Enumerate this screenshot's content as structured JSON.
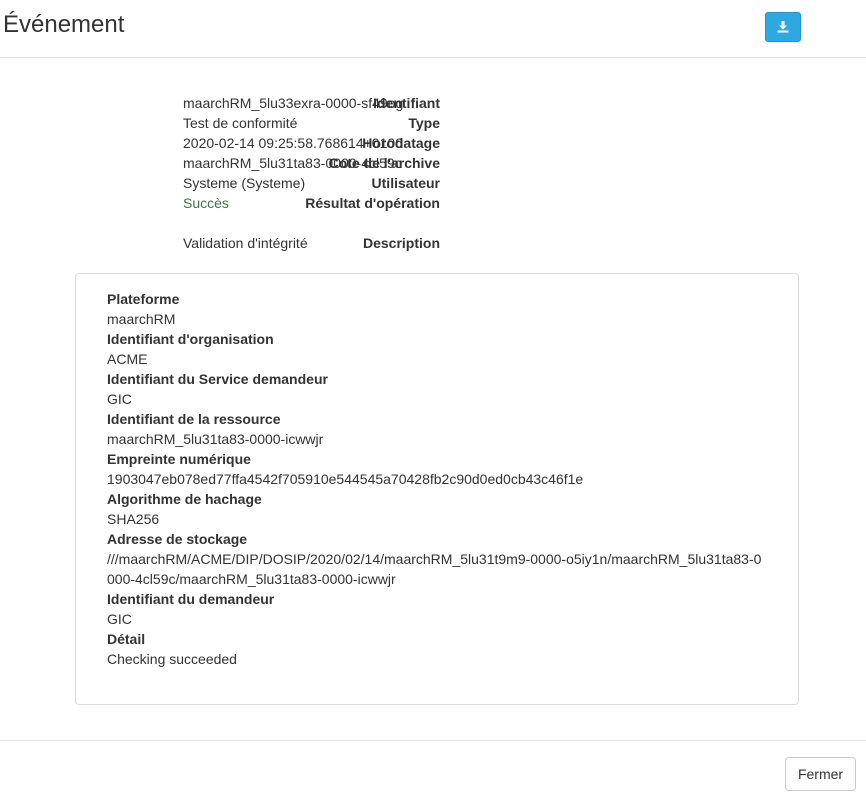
{
  "modal": {
    "title": "Événement",
    "download_icon": "download-icon",
    "close_label": "Fermer"
  },
  "fields": [
    {
      "label": "Identifiant",
      "value": "maarchRM_5lu33exra-0000-sf49og"
    },
    {
      "label": "Type",
      "value": "Test de conformité"
    },
    {
      "label": "Horodatage",
      "value": "2020-02-14 09:25:58.768614+0100"
    },
    {
      "label": "Cote de l'archive",
      "value": "maarchRM_5lu31ta83-0000-4cl59c"
    },
    {
      "label": "Utilisateur",
      "value": "Systeme (Systeme)"
    },
    {
      "label": "Résultat d'opération",
      "value": "Succès"
    }
  ],
  "description": {
    "label": "Description",
    "value": "Validation d'intégrité"
  },
  "details": [
    {
      "key": "Plateforme",
      "value": "maarchRM"
    },
    {
      "key": "Identifiant d'organisation",
      "value": "ACME"
    },
    {
      "key": "Identifiant du Service demandeur",
      "value": "GIC"
    },
    {
      "key": "Identifiant de la ressource",
      "value": "maarchRM_5lu31ta83-0000-icwwjr"
    },
    {
      "key": "Empreinte numérique",
      "value": "1903047eb078ed77ffa4542f705910e544545a70428fb2c90d0ed0cb43c46f1e"
    },
    {
      "key": "Algorithme de hachage",
      "value": "SHA256"
    },
    {
      "key": "Adresse de stockage",
      "value_line1": "///maarchRM/ACME/DIP/DOSIP/2020/02/14/maarchRM_5lu31t9m9-0000-o5iy1n/maarchRM_5lu31ta83-0",
      "value_line2": "000-4cl59c/maarchRM_5lu31ta83-0000-icwwjr"
    },
    {
      "key": "Identifiant du demandeur",
      "value": "GIC"
    },
    {
      "key": "Détail",
      "value": "Checking succeeded"
    }
  ],
  "colors": {
    "primary": "#2ea8e0",
    "success": "#3c763d"
  }
}
